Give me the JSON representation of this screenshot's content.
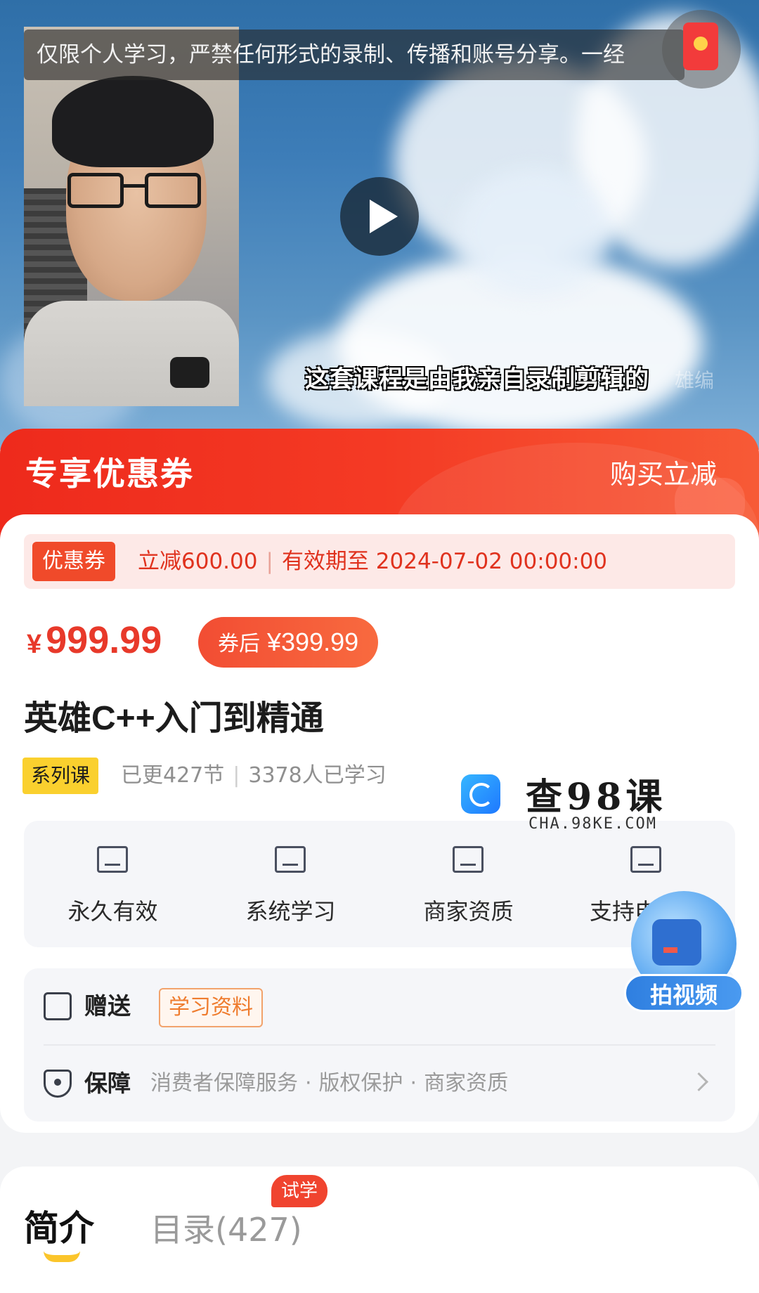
{
  "video": {
    "notice": "仅限个人学习，严禁任何形式的录制、传播和账号分享。一经",
    "subtitle": "这套课程是由我亲自录制剪辑的",
    "watermark_fragment": "雄编"
  },
  "coupon_header": {
    "title": "专享优惠券",
    "action": "购买立减"
  },
  "coupon": {
    "tag": "优惠券",
    "discount": "立减600.00",
    "validity": "有效期至 2024-07-02 00:00:00",
    "separator": "|"
  },
  "pricing": {
    "currency": "¥",
    "price": "999.99",
    "after_label": "券后",
    "after_price": "¥399.99"
  },
  "course": {
    "title": "英雄C++入门到精通",
    "series_tag": "系列课",
    "updated": "已更427节",
    "learners": "3378人已学习",
    "separator": "|"
  },
  "features": [
    {
      "label": "永久有效",
      "icon": "calendar-check-icon"
    },
    {
      "label": "系统学习",
      "icon": "folder-plus-icon"
    },
    {
      "label": "商家资质",
      "icon": "id-card-icon"
    },
    {
      "label": "支持电",
      "icon": "monitor-play-icon"
    }
  ],
  "float_widget": {
    "label": "拍视频"
  },
  "service": {
    "gift_title": "赠送",
    "gift_tag": "学习资料",
    "guarantee_title": "保障",
    "guarantee_items": [
      "消费者保障服务",
      "版权保护",
      "商家资质"
    ],
    "dot": "·"
  },
  "brand_watermark": {
    "name": "查98课",
    "url": "CHA.98KE.COM"
  },
  "tabs": {
    "intro": "简介",
    "catalog": "目录(427)",
    "trial_badge": "试学"
  },
  "colors": {
    "accent_red": "#ee2a1c",
    "price_red": "#e8392a",
    "tag_yellow": "#fad02e",
    "tab_underline": "#fbc52b",
    "gift_orange": "#ef7c2e"
  }
}
